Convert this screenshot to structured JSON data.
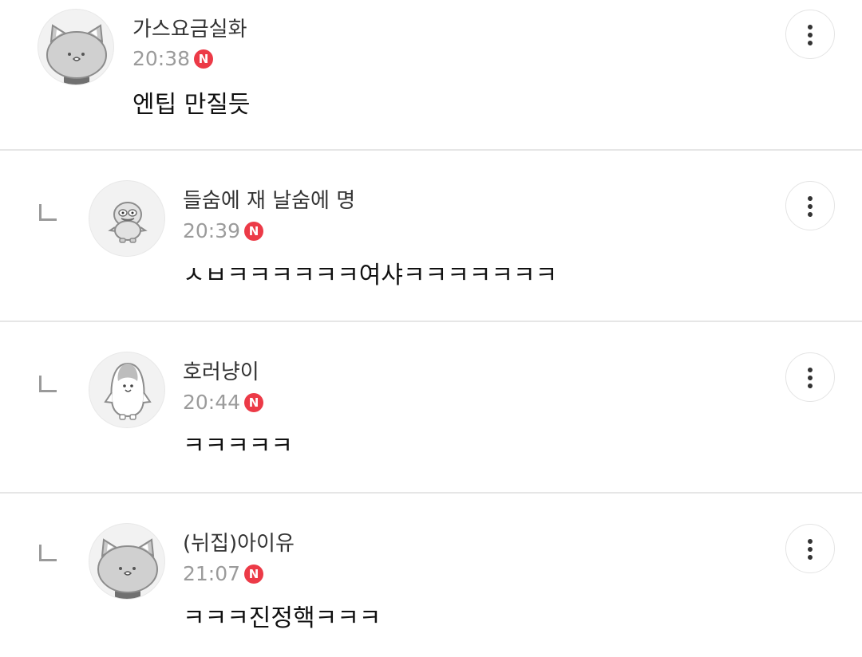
{
  "comments": [
    {
      "nickname": "가스요금실화",
      "time": "20:38",
      "badge": "N",
      "content": "엔팁 만질듯",
      "avatar": "cat-avatar",
      "is_reply": false
    },
    {
      "nickname": "들숨에 재 날숨에 명",
      "time": "20:39",
      "badge": "N",
      "content": "ㅅㅂㅋㅋㅋㅋㅋㅋ여샤ㅋㅋㅋㅋㅋㅋㅋ",
      "avatar": "duck-avatar",
      "is_reply": true
    },
    {
      "nickname": "호러냥이",
      "time": "20:44",
      "badge": "N",
      "content": "ㅋㅋㅋㅋㅋ",
      "avatar": "penguin-avatar",
      "is_reply": true
    },
    {
      "nickname": "(뉘집)아이유",
      "time": "21:07",
      "badge": "N",
      "content": "ㅋㅋㅋ진정핵ㅋㅋㅋ",
      "avatar": "cat-avatar",
      "is_reply": true
    }
  ],
  "colors": {
    "badge": "#ec3a47",
    "divider": "#e6e6e6",
    "time": "#9b9b9b"
  },
  "icons": {
    "more": "more-vertical-icon",
    "reply": "reply-indent-icon",
    "badge": "new-badge-icon"
  }
}
